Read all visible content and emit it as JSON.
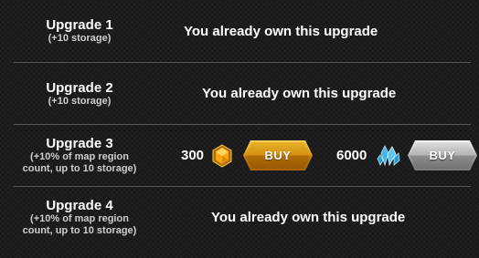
{
  "upgrades": [
    {
      "title": "Upgrade 1",
      "subtitle": [
        "(+10 storage)"
      ],
      "status": "You already own this upgrade"
    },
    {
      "title": "Upgrade 2",
      "subtitle": [
        "(+10 storage)"
      ],
      "status": "You already own this upgrade"
    },
    {
      "title": "Upgrade 3",
      "subtitle": [
        "(+10% of map region",
        "count, up to 10 storage)"
      ],
      "gold_price": "300",
      "gold_icon": "gold-coin-icon",
      "gold_buy_label": "BUY",
      "crystal_price": "6000",
      "crystal_icon": "blue-crystal-icon",
      "crystal_buy_label": "BUY"
    },
    {
      "title": "Upgrade 4",
      "subtitle": [
        "(+10% of map region",
        "count, up to 10 storage)"
      ],
      "status": "You already own this upgrade"
    }
  ],
  "colors": {
    "background": "#1c1c1c",
    "divider": "#5a5a5a",
    "gold_button": "#e0a01a",
    "silver_button": "#a8a8a8",
    "subtitle_text": "#cfcfcf"
  }
}
